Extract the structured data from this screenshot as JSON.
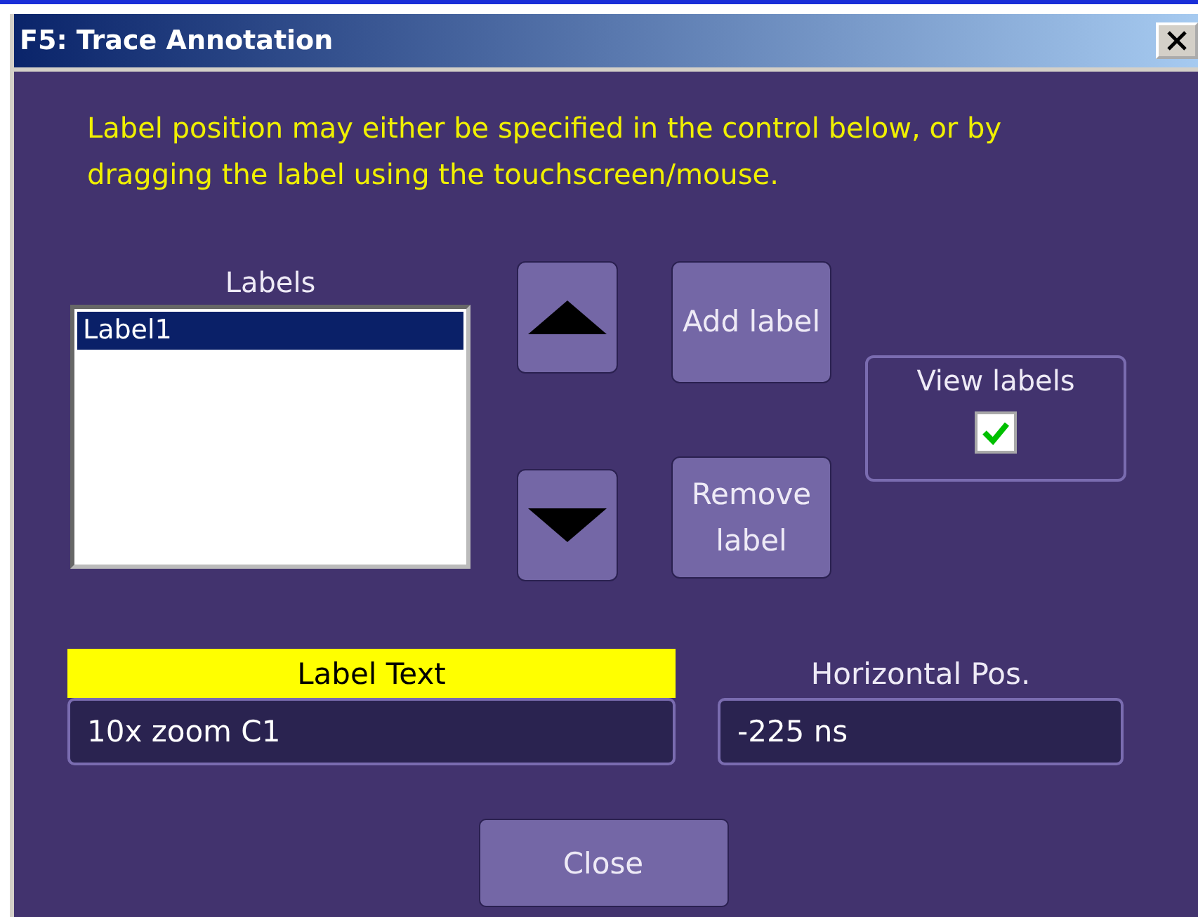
{
  "window": {
    "title": "F5: Trace Annotation"
  },
  "instructions": "Label position may either be specified in the control below, or by dragging the label using the touchscreen/mouse.",
  "labels_list": {
    "heading": "Labels",
    "items": [
      {
        "text": "Label1",
        "selected": true
      }
    ]
  },
  "action_buttons": [
    "Add label",
    "Remove label"
  ],
  "view_labels": {
    "label": "View labels",
    "checked": true
  },
  "fields": [
    {
      "label": "Label Text",
      "value": "10x zoom C1",
      "selected": true
    },
    {
      "label": "Horizontal Pos.",
      "value": "-225 ns",
      "selected": false
    }
  ],
  "close_button": "Close"
}
